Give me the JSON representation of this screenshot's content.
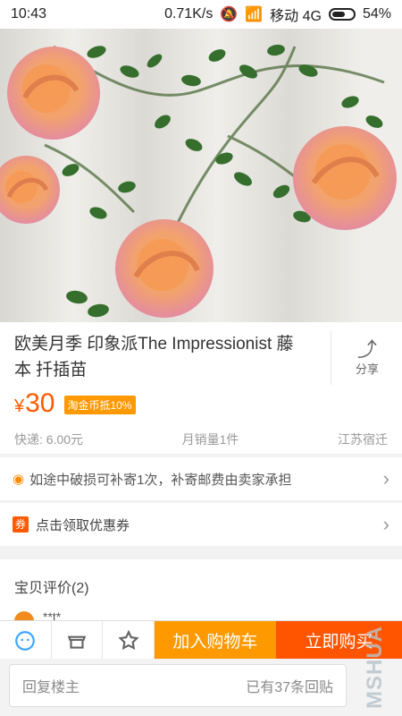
{
  "statusbar": {
    "time": "10:43",
    "speed": "0.71K/s",
    "network": "移动 4G",
    "battery": "54%"
  },
  "product": {
    "title": "欧美月季 印象派The Impressionist 藤本 扦插苗",
    "share": "分享",
    "price": "30",
    "currency": "¥",
    "badge": "淘金币抵10%",
    "shipping": "快递: 6.00元",
    "sales": "月销量1件",
    "location": "江苏宿迁"
  },
  "notice": {
    "text": "如途中破损可补寄1次，补寄邮费由卖家承担"
  },
  "coupon": {
    "text": "点击领取优惠券"
  },
  "reviews": {
    "title": "宝贝评价(2)"
  },
  "bottom": {
    "cart": "加入购物车",
    "buy": "立即购买"
  },
  "reply": {
    "placeholder": "回复楼主",
    "count": "已有37条回贴"
  },
  "watermark": "MSHUA"
}
